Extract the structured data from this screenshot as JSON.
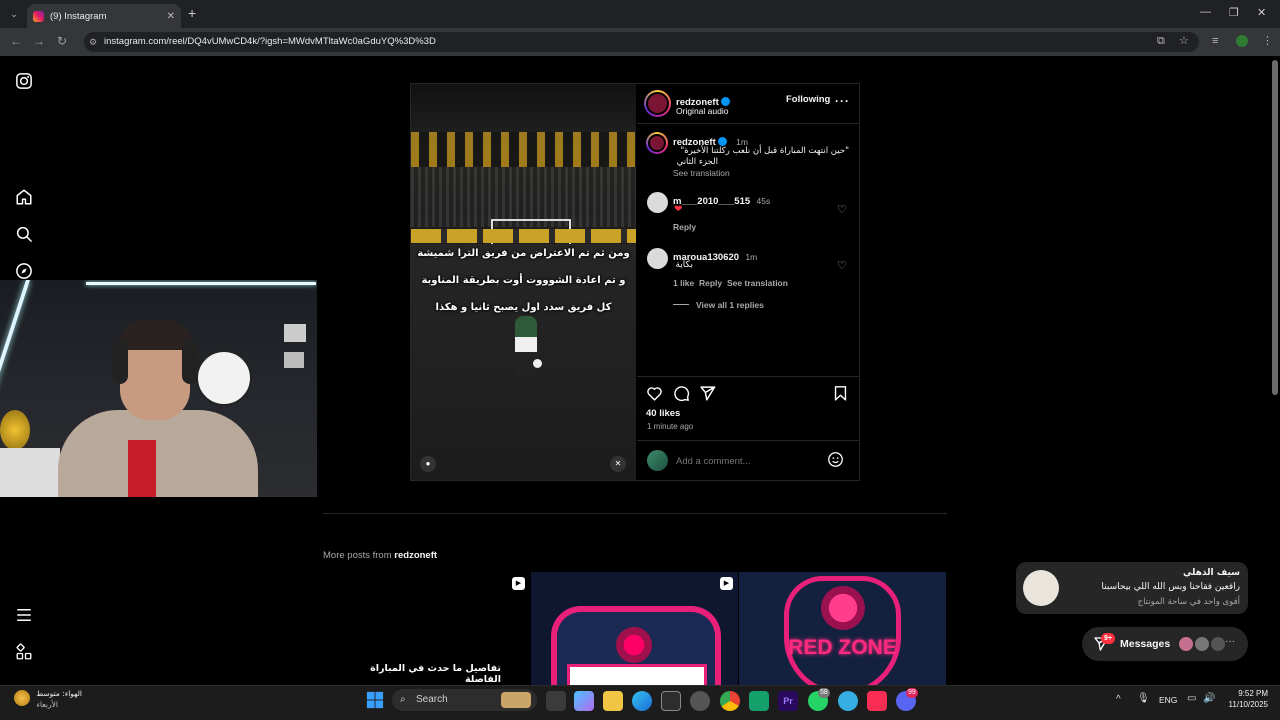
{
  "browser": {
    "tab_title": "(9) Instagram",
    "url": "instagram.com/reel/DQ4vUMwCD4k/?igsh=MWdvMTltaWc0aGduYQ%3D%3D"
  },
  "post": {
    "username": "redzoneft",
    "audio": "Original audio",
    "follow_label": "Following",
    "caption_user": "redzoneft",
    "caption_time": "1m",
    "caption_line1": "\"حين انتهت المباراة قبل أن نلعب ركلتنا الأخيرة\"",
    "caption_line2": "الجزء الثاني",
    "see_translation": "See translation",
    "likes": "40 likes",
    "time_ago": "1 minute ago",
    "comment_placeholder": "Add a comment..."
  },
  "video_captions": {
    "line1": "ومن ثم تم الاعتراض من فريق الترا شميشة",
    "line2": "و تم اعادة الشوووت أوت بطريقة المناوبة",
    "line3": "كل فريق سدد اول يصبح ثانيا و هكذا"
  },
  "comments": [
    {
      "user": "m___2010___515",
      "time": "45s",
      "text": "❤",
      "reply": "Reply"
    },
    {
      "user": "maroua130620",
      "time": "1m",
      "text": "بكاية",
      "likes": "1 like",
      "reply": "Reply",
      "translate": "See translation",
      "view_replies": "View all 1 replies"
    }
  ],
  "more_posts": {
    "prefix": "More posts from ",
    "user": "redzoneft",
    "thumb_text": "تفاصيل ما حدث في المباراة الفاصلة",
    "logo_text": "RED ZONE"
  },
  "notification": {
    "sender": "سيف الذهلي",
    "line1": "رافعين فقاحنا وبس الله اللي بيحاسبنا",
    "line2": "أقوى واحد في ساحة المونتاج"
  },
  "messages": {
    "label": "Messages",
    "badge": "9+"
  },
  "taskbar": {
    "weather_line1": "الهواء: متوسط",
    "weather_line2": "الأربعاء",
    "search_label": "Search",
    "lang": "ENG",
    "time": "9:52 PM",
    "date": "11/10/2025",
    "badge_chrome": "58",
    "badge_discord": "99"
  },
  "colors": {
    "ig_blue": "#0095f6",
    "like_red": "#ff3040",
    "brand_pink": "#e8207a"
  }
}
